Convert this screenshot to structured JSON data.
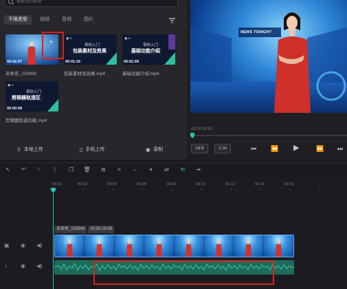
{
  "search": {
    "placeholder": "搜索我的素材"
  },
  "tabs": [
    {
      "label": "不限类型",
      "active": true
    },
    {
      "label": "视频",
      "active": false
    },
    {
      "label": "音频",
      "active": false
    },
    {
      "label": "图片",
      "active": false
    }
  ],
  "media": [
    {
      "name": "未命名_220908",
      "duration": "00:02:37",
      "kind": "video"
    },
    {
      "name": "包装素材及效果.mp4",
      "duration": "00:01:16",
      "kind": "tutorial",
      "caption": "带你入门",
      "title": "包装素材及效果"
    },
    {
      "name": "基础功能介绍.mp4",
      "duration": "00:01:59",
      "kind": "tutorial",
      "caption": "带你入门",
      "title": "基础功能介绍"
    },
    {
      "name": "剪辑器轨道功能.mp4",
      "duration": "00:00:58",
      "kind": "tutorial",
      "caption": "带你入门",
      "title": "剪辑器轨道区"
    }
  ],
  "upload_bar": {
    "local_upload": "本地上传",
    "phone_upload": "手机上传",
    "record": "录制"
  },
  "preview": {
    "banner_text": "NEWS TONIGHT",
    "current_time": "00:00:00:00",
    "aspect": "16:9",
    "speed": "1.0x"
  },
  "timeline": {
    "ruler": [
      "00:00",
      "00:02",
      "00:04",
      "00:06",
      "00:08",
      "00:10",
      "00:12",
      "00:14",
      "00:16"
    ],
    "clip_name": "未命名_220908",
    "clip_duration": "00:00:16:08"
  },
  "colors": {
    "accent": "#27c4b5",
    "selection": "#e02020",
    "panel": "#26262b"
  }
}
